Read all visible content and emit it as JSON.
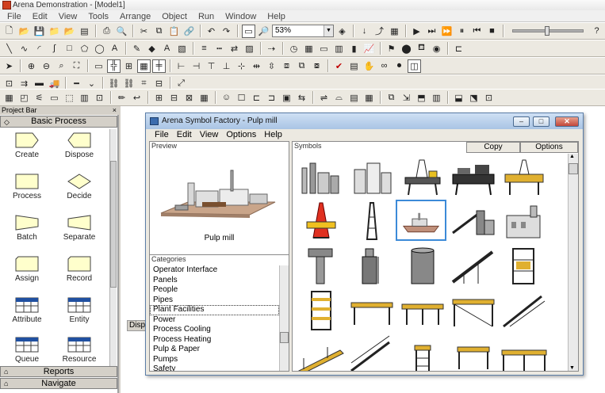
{
  "window": {
    "title": "Arena Demonstration - [Model1]"
  },
  "menu": [
    "File",
    "Edit",
    "View",
    "Tools",
    "Arrange",
    "Object",
    "Run",
    "Window",
    "Help"
  ],
  "toolbar": {
    "zoom_value": "53%",
    "help_icon": "?"
  },
  "project_bar": {
    "title": "Project Bar",
    "close_glyph": "×",
    "panel_title": "Basic Process",
    "modules": [
      {
        "label": "Create",
        "shape": "pentagon-right"
      },
      {
        "label": "Dispose",
        "shape": "pentagon-left"
      },
      {
        "label": "Process",
        "shape": "rect"
      },
      {
        "label": "Decide",
        "shape": "diamond"
      },
      {
        "label": "Batch",
        "shape": "batch"
      },
      {
        "label": "Separate",
        "shape": "separate"
      },
      {
        "label": "Assign",
        "shape": "rect-notch"
      },
      {
        "label": "Record",
        "shape": "rect-notch"
      },
      {
        "label": "Attribute",
        "shape": "table"
      },
      {
        "label": "Entity",
        "shape": "table"
      },
      {
        "label": "Queue",
        "shape": "table"
      },
      {
        "label": "Resource",
        "shape": "table"
      }
    ],
    "bottom_panels": [
      "Reports",
      "Navigate"
    ]
  },
  "model_window": {
    "tab_label": "Disp"
  },
  "dialog": {
    "title": "Arena Symbol Factory - Pulp mill",
    "menu": [
      "File",
      "Edit",
      "View",
      "Options",
      "Help"
    ],
    "preview_label": "Preview",
    "preview_caption": "Pulp mill",
    "categories_label": "Categories",
    "categories": [
      "Operator Interface",
      "Panels",
      "People",
      "Pipes",
      "Plant Facilities",
      "Power",
      "Process Cooling",
      "Process Heating",
      "Pulp & Paper",
      "Pumps",
      "Safety"
    ],
    "selected_category": "Plant Facilities",
    "symbols_label": "Symbols",
    "copy_label": "Copy",
    "options_label": "Options",
    "symbols": [
      "refinery-symbol",
      "storage-tanks-symbol",
      "offshore-rig-symbol",
      "oil-platform-symbol",
      "drilling-platform-symbol",
      "oil-derrick-symbol",
      "tower-symbol",
      "pulp-mill-symbol",
      "conveyor-plant-symbol",
      "factory-building-symbol",
      "water-tower-symbol",
      "silo-tank-symbol",
      "cylindrical-tank-symbol",
      "inclined-conveyor-symbol",
      "rack-frame-symbol",
      "shelving-tower-symbol",
      "platform-symbol",
      "table-stand-symbol",
      "elevated-deck-symbol",
      "stairway-symbol",
      "ramp-walkway-symbol",
      "handrail-stairs-symbol",
      "ladder-tower-symbol",
      "work-bench-symbol",
      "mezzanine-symbol"
    ],
    "selected_symbol": "pulp-mill-symbol"
  }
}
